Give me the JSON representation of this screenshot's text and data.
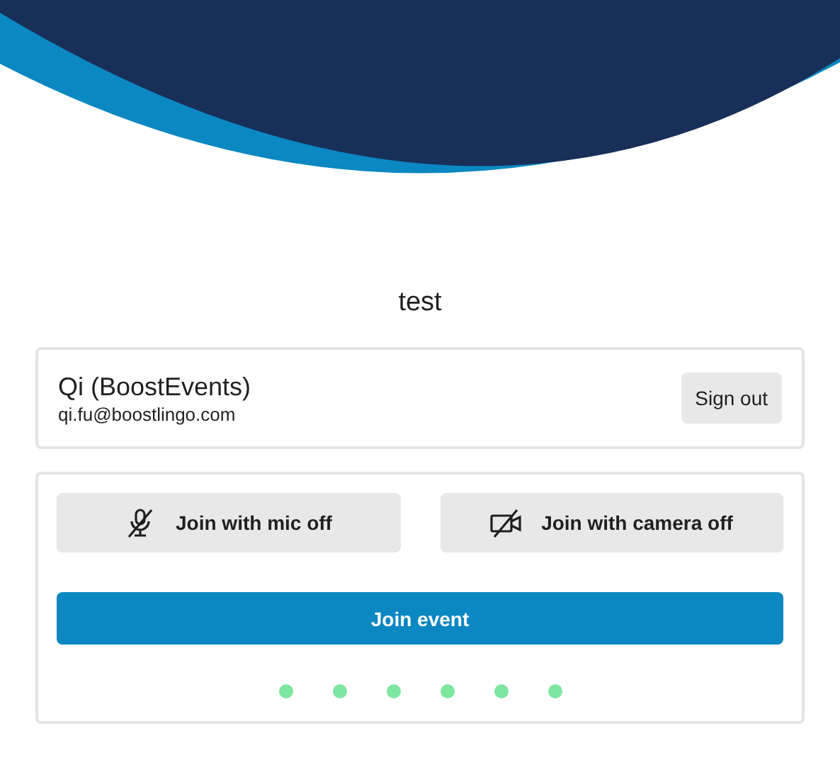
{
  "event": {
    "title": "test"
  },
  "account": {
    "name": "Qi (BoostEvents)",
    "email": "qi.fu@boostlingo.com",
    "sign_out": "Sign out"
  },
  "options": [
    {
      "kind": "mic",
      "label": "Join with mic off"
    },
    {
      "kind": "camera",
      "label": "Join with camera off"
    }
  ],
  "join_button": "Join event"
}
